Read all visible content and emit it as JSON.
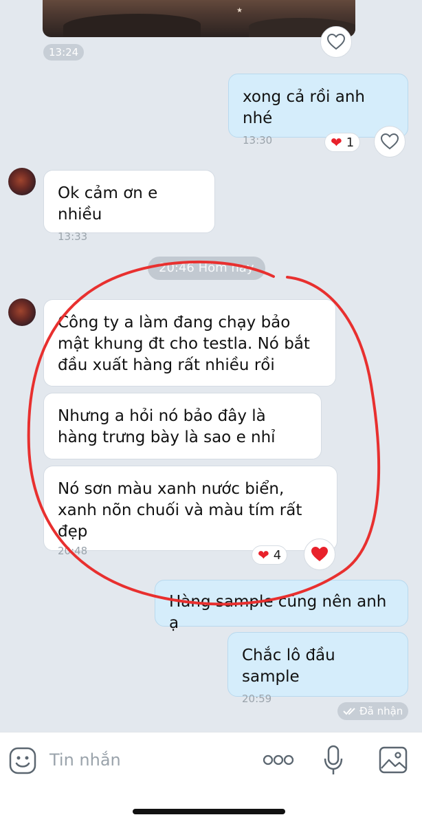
{
  "messages": {
    "photo_time": "13:24",
    "msg1": {
      "text": "xong cả rồi anh nhé",
      "time": "13:30",
      "reaction_count": "1"
    },
    "msg2": {
      "text": "Ok cảm ơn e nhiều",
      "time": "13:33"
    },
    "date_separator": "20:46 Hôm nay",
    "msg3": {
      "text": "Công ty a làm đang chạy bảo mật khung đt cho testla. Nó bắt đầu xuất hàng rất nhiều rồi"
    },
    "msg4": {
      "text": "Nhưng a hỏi nó bảo đây là hàng trưng bày là sao e nhỉ"
    },
    "msg5": {
      "text": "Nó sơn màu xanh nước biển, xanh nõn chuối và màu tím rất đẹp",
      "time": "20:48",
      "reaction_count": "4"
    },
    "msg6": {
      "text": "Hàng sample cũng nên anh ạ"
    },
    "msg7": {
      "text": "Chắc lô đầu sample",
      "time": "20:59"
    },
    "status": "Đã nhận"
  },
  "composer": {
    "placeholder": "Tin nhắn"
  },
  "icons": {
    "reaction": "heart-outline-icon",
    "reacted": "heart-filled-icon",
    "emoji": "sticker-face-icon",
    "more": "more-dots-icon",
    "mic": "microphone-icon",
    "image": "image-icon",
    "seen": "double-check-icon"
  },
  "colors": {
    "background": "#e3e8ee",
    "incoming_bubble": "#ffffff",
    "outgoing_bubble": "#d5edfb",
    "annotation": "#e8302f",
    "heart": "#e8212b"
  }
}
